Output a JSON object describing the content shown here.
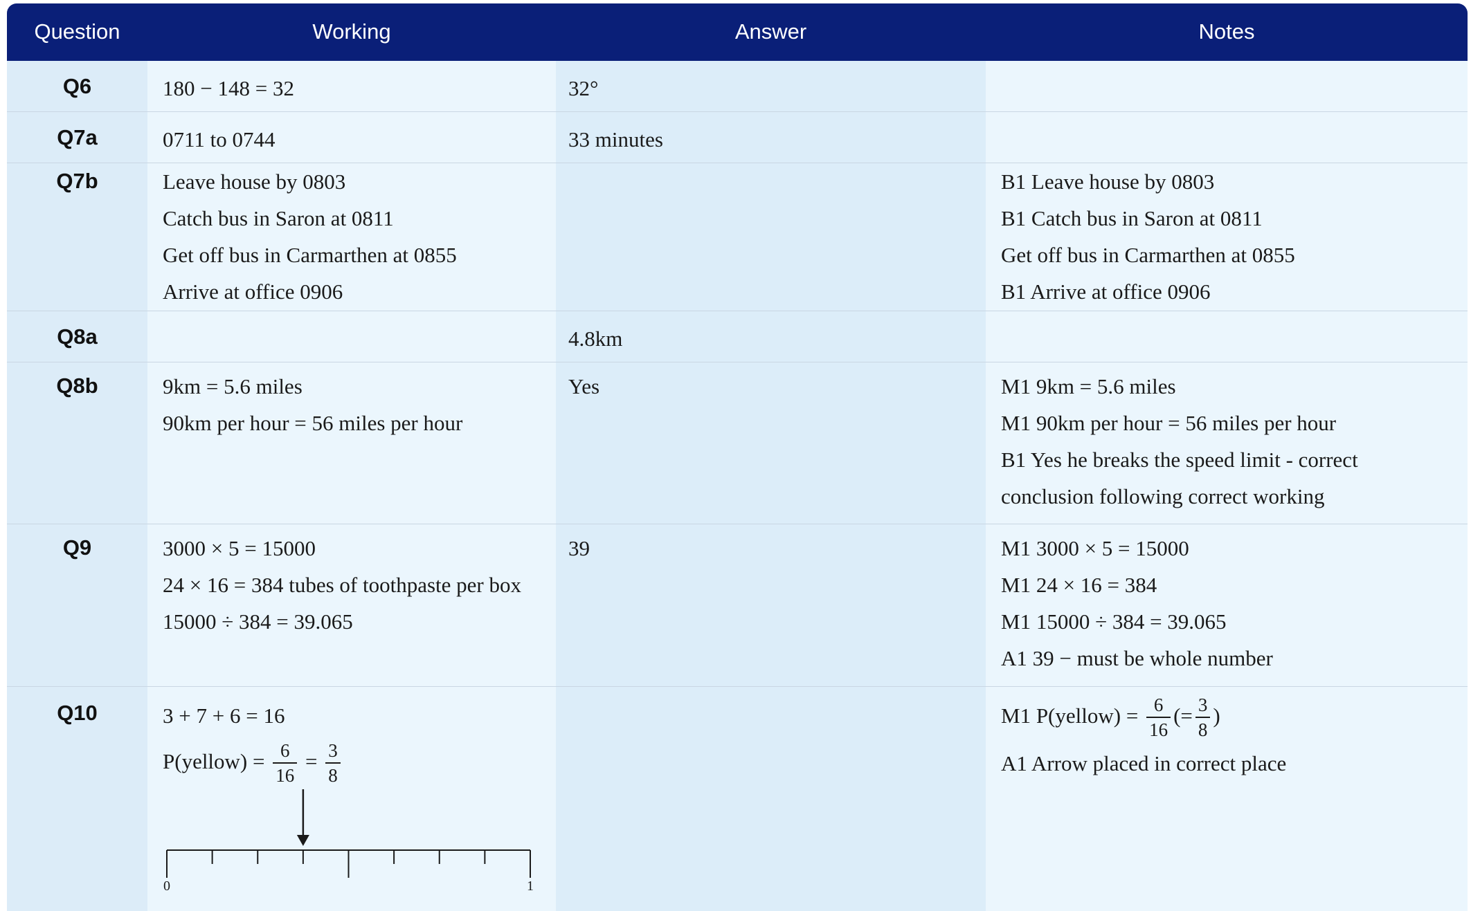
{
  "header": {
    "question": "Question",
    "working": "Working",
    "answer": "Answer",
    "notes": "Notes"
  },
  "rows": [
    {
      "question": "Q6",
      "working": [
        "180 − 148 = 32"
      ],
      "answer": [
        "32°"
      ],
      "notes": []
    },
    {
      "question": "Q7a",
      "working": [
        "0711 to 0744"
      ],
      "answer": [
        "33 minutes"
      ],
      "notes": []
    },
    {
      "question": "Q7b",
      "working": [
        "Leave house by 0803",
        "Catch bus in Saron at 0811",
        "Get off bus in Carmarthen at 0855",
        "Arrive at office 0906"
      ],
      "answer": [],
      "notes": [
        "B1 Leave house by 0803",
        "B1 Catch bus in Saron at 0811",
        "Get off bus in Carmarthen at 0855",
        "B1 Arrive at office 0906"
      ]
    },
    {
      "question": "Q8a",
      "working": [],
      "answer": [
        "4.8km"
      ],
      "notes": []
    },
    {
      "question": "Q8b",
      "working": [
        "9km = 5.6 miles",
        "90km per hour = 56 miles per hour"
      ],
      "answer": [
        "Yes"
      ],
      "notes": [
        "M1 9km = 5.6 miles",
        "M1 90km per hour = 56 miles per hour",
        "B1 Yes he breaks the speed limit - correct",
        "conclusion following correct working"
      ]
    },
    {
      "question": "Q9",
      "working": [
        "3000 × 5 = 15000",
        "24 × 16 = 384 tubes of toothpaste per box",
        "15000 ÷ 384 = 39.065"
      ],
      "answer": [
        "39"
      ],
      "notes": [
        "M1 3000 × 5 = 15000",
        "M1 24 × 16 = 384",
        "M1 15000 ÷ 384 = 39.065",
        "A1 39 − must be whole number"
      ]
    },
    {
      "question": "Q10",
      "working_line1": "3 + 7 + 6 = 16",
      "working_prob_prefix": "P(yellow) =",
      "working_frac1": {
        "num": "6",
        "den": "16"
      },
      "working_eq": "=",
      "working_frac2": {
        "num": "3",
        "den": "8"
      },
      "number_line": {
        "start_label": "0",
        "end_label": "1",
        "divisions": 8,
        "arrow_at": 0.375
      },
      "answer": [],
      "notes_prob_prefix": "M1 P(yellow) =",
      "notes_frac1": {
        "num": "6",
        "den": "16"
      },
      "notes_open": "(=",
      "notes_frac2": {
        "num": "3",
        "den": "8"
      },
      "notes_close": ")",
      "notes_line2": "A1 Arrow placed in correct place"
    }
  ]
}
